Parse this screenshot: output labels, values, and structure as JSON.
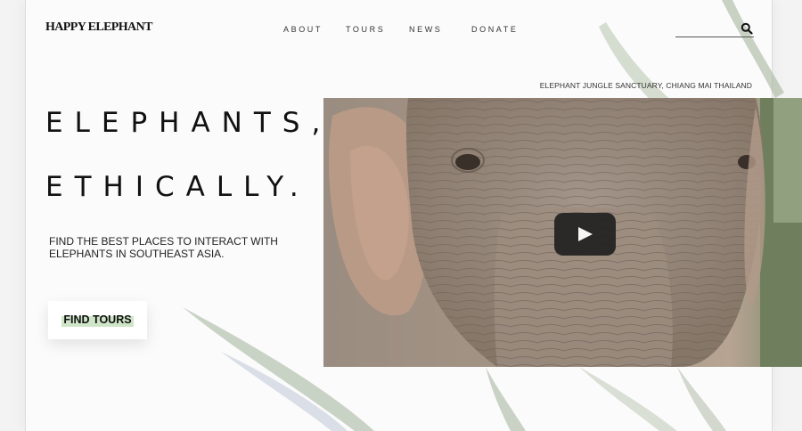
{
  "brand": {
    "name": "HAPPY ELEPHANT"
  },
  "nav": {
    "items": [
      {
        "label": "ABOUT"
      },
      {
        "label": "TOURS"
      },
      {
        "label": "NEWS"
      },
      {
        "label": "DONATE"
      }
    ]
  },
  "search": {
    "icon": "search-icon"
  },
  "hero": {
    "caption": "ELEPHANT JUNGLE SANCTUARY, CHIANG MAI THAILAND",
    "headline_line1": "ELEPHANTS,",
    "headline_line2": "ETHICALLY.",
    "subtitle": "FIND THE BEST PLACES TO INTERACT WITH ELEPHANTS IN SOUTHEAST ASIA.",
    "cta_label": "FIND TOURS",
    "cta_highlight_color": "#cfe5c8"
  },
  "video": {
    "play_icon": "play-icon"
  }
}
